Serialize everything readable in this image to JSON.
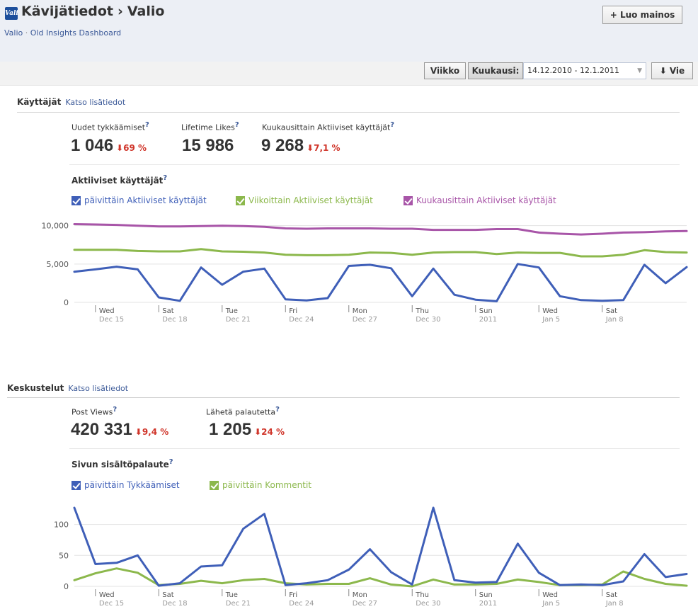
{
  "header": {
    "logo_text": "Valio",
    "title": "Kävijätiedot",
    "title_sep": "›",
    "title_page": "Valio",
    "subtitle_page": "Valio",
    "subtitle_dot": "·",
    "subtitle_link": "Old Insights Dashboard",
    "create_ad_label": "+ Luo mainos"
  },
  "toolbar": {
    "week_label": "Viikko",
    "month_label": "Kuukausi:",
    "date_range": "14.12.2010 - 12.1.2011",
    "export_label": "Vie"
  },
  "users_section": {
    "title": "Käyttäjät",
    "more_link": "Katso lisätiedot",
    "metrics": [
      {
        "label": "Uudet tykkäämiset",
        "help": "?",
        "value": "1 046",
        "delta": "69 %"
      },
      {
        "label": "Lifetime Likes",
        "help": "?",
        "value": "15 986",
        "delta": ""
      },
      {
        "label": "Kuukausittain Aktiiviset käyttäjät",
        "help": "?",
        "value": "9 268",
        "delta": "7,1 %"
      }
    ],
    "chart_title": "Aktiiviset käyttäjät",
    "chart_help": "?",
    "legend": [
      {
        "label": "päivittäin Aktiiviset käyttäjät",
        "color": "#3f5fb8"
      },
      {
        "label": "Viikoittain Aktiiviset käyttäjät",
        "color": "#8cb84c"
      },
      {
        "label": "Kuukausittain Aktiiviset käyttäjät",
        "color": "#a855a8"
      }
    ]
  },
  "conversations_section": {
    "title": "Keskustelut",
    "more_link": "Katso lisätiedot",
    "metrics": [
      {
        "label": "Post Views",
        "help": "?",
        "value": "420 331",
        "delta": "9,4 %"
      },
      {
        "label": "Lähetä palautetta",
        "help": "?",
        "value": "1 205",
        "delta": "24 %"
      }
    ],
    "chart_title": "Sivun sisältöpalaute",
    "chart_help": "?",
    "legend": [
      {
        "label": "päivittäin Tykkäämiset",
        "color": "#3f5fb8"
      },
      {
        "label": "päivittäin Kommentit",
        "color": "#8cb84c"
      }
    ]
  },
  "chart_data": [
    {
      "type": "line",
      "title": "Aktiiviset käyttäjät",
      "x": [
        "Dec 14",
        "Dec 15",
        "Dec 16",
        "Dec 17",
        "Dec 18",
        "Dec 19",
        "Dec 20",
        "Dec 21",
        "Dec 22",
        "Dec 23",
        "Dec 24",
        "Dec 25",
        "Dec 26",
        "Dec 27",
        "Dec 28",
        "Dec 29",
        "Dec 30",
        "Dec 31",
        "Jan 1",
        "Jan 2",
        "Jan 3",
        "Jan 4",
        "Jan 5",
        "Jan 6",
        "Jan 7",
        "Jan 8",
        "Jan 9",
        "Jan 10",
        "Jan 11",
        "Jan 12"
      ],
      "x_tick_labels": [
        [
          "Wed",
          "Dec 15"
        ],
        [
          "Sat",
          "Dec 18"
        ],
        [
          "Tue",
          "Dec 21"
        ],
        [
          "Fri",
          "Dec 24"
        ],
        [
          "Mon",
          "Dec 27"
        ],
        [
          "Thu",
          "Dec 30"
        ],
        [
          "Sun",
          "2011"
        ],
        [
          "Wed",
          "Jan 5"
        ],
        [
          "Sat",
          "Jan 8"
        ]
      ],
      "x_tick_index": [
        1,
        4,
        7,
        10,
        13,
        16,
        19,
        22,
        25
      ],
      "y_ticks": [
        0,
        5000,
        10000
      ],
      "y_tick_labels": [
        "0",
        "5,000",
        "10,000"
      ],
      "ylim": [
        0,
        10800
      ],
      "grid": true,
      "series": [
        {
          "name": "päivittäin Aktiiviset käyttäjät",
          "color": "#3f5fb8",
          "values": [
            4000,
            4300,
            4650,
            4300,
            650,
            200,
            4550,
            2300,
            4000,
            4400,
            400,
            250,
            550,
            4750,
            4900,
            4450,
            800,
            4400,
            1000,
            350,
            150,
            5000,
            4550,
            800,
            300,
            200,
            300,
            4900,
            2500,
            4600
          ]
        },
        {
          "name": "Viikoittain Aktiiviset käyttäjät",
          "color": "#8cb84c",
          "values": [
            6850,
            6850,
            6850,
            6700,
            6650,
            6650,
            6950,
            6650,
            6600,
            6500,
            6200,
            6150,
            6150,
            6200,
            6500,
            6450,
            6200,
            6500,
            6550,
            6550,
            6300,
            6500,
            6450,
            6450,
            6000,
            6000,
            6200,
            6800,
            6550,
            6500
          ]
        },
        {
          "name": "Kuukausittain Aktiiviset käyttäjät",
          "color": "#a855a8",
          "values": [
            10200,
            10150,
            10100,
            10000,
            9900,
            9900,
            9950,
            10000,
            9950,
            9850,
            9650,
            9600,
            9650,
            9650,
            9650,
            9600,
            9600,
            9450,
            9450,
            9450,
            9550,
            9550,
            9100,
            8950,
            8850,
            8950,
            9100,
            9150,
            9250,
            9300
          ]
        }
      ]
    },
    {
      "type": "line",
      "title": "Sivun sisältöpalaute",
      "x": [
        "Dec 14",
        "Dec 15",
        "Dec 16",
        "Dec 17",
        "Dec 18",
        "Dec 19",
        "Dec 20",
        "Dec 21",
        "Dec 22",
        "Dec 23",
        "Dec 24",
        "Dec 25",
        "Dec 26",
        "Dec 27",
        "Dec 28",
        "Dec 29",
        "Dec 30",
        "Dec 31",
        "Jan 1",
        "Jan 2",
        "Jan 3",
        "Jan 4",
        "Jan 5",
        "Jan 6",
        "Jan 7",
        "Jan 8",
        "Jan 9",
        "Jan 10",
        "Jan 11",
        "Jan 12"
      ],
      "x_tick_labels": [
        [
          "Wed",
          "Dec 15"
        ],
        [
          "Sat",
          "Dec 18"
        ],
        [
          "Tue",
          "Dec 21"
        ],
        [
          "Fri",
          "Dec 24"
        ],
        [
          "Mon",
          "Dec 27"
        ],
        [
          "Thu",
          "Dec 30"
        ],
        [
          "Sun",
          "2011"
        ],
        [
          "Wed",
          "Jan 5"
        ],
        [
          "Sat",
          "Jan 8"
        ]
      ],
      "x_tick_index": [
        1,
        4,
        7,
        10,
        13,
        16,
        19,
        22,
        25
      ],
      "y_ticks": [
        0,
        50,
        100
      ],
      "y_tick_labels": [
        "0",
        "50",
        "100"
      ],
      "ylim": [
        0,
        135
      ],
      "grid": true,
      "series": [
        {
          "name": "päivittäin Tykkäämiset",
          "color": "#3f5fb8",
          "values": [
            127,
            36,
            38,
            50,
            1,
            5,
            32,
            34,
            93,
            117,
            2,
            5,
            10,
            27,
            60,
            23,
            3,
            127,
            10,
            6,
            7,
            69,
            22,
            2,
            3,
            2,
            8,
            52,
            15,
            20
          ]
        },
        {
          "name": "päivittäin Kommentit",
          "color": "#8cb84c",
          "values": [
            10,
            21,
            29,
            22,
            2,
            4,
            9,
            5,
            10,
            12,
            5,
            3,
            4,
            4,
            13,
            3,
            0,
            11,
            3,
            3,
            4,
            11,
            7,
            2,
            2,
            3,
            24,
            12,
            4,
            1
          ]
        }
      ]
    }
  ]
}
